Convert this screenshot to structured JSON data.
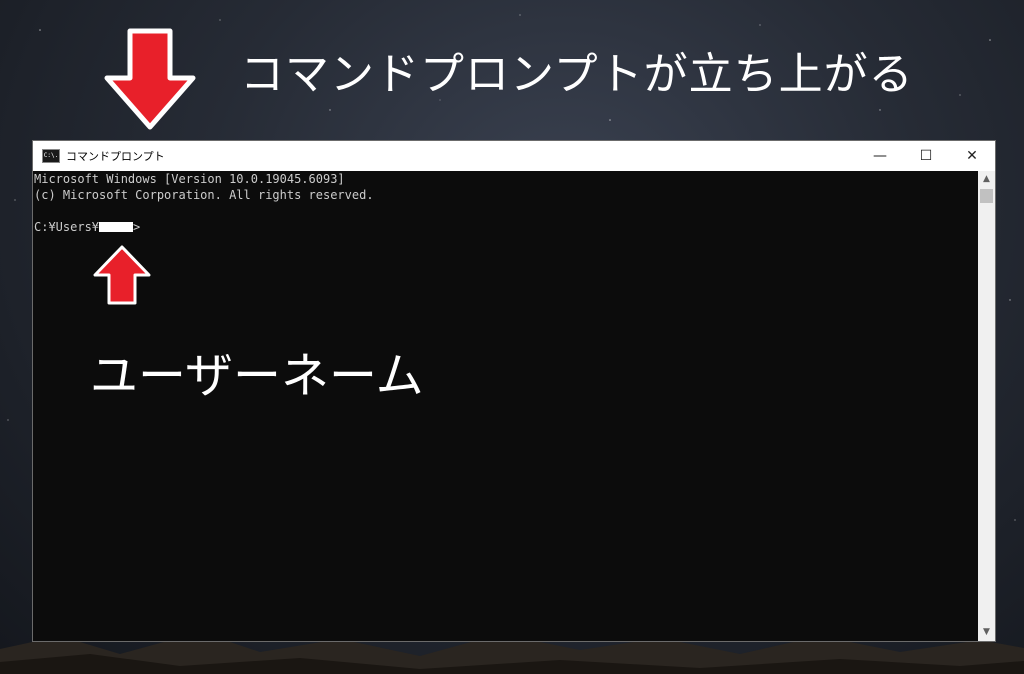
{
  "annotations": {
    "heading": "コマンドプロンプトが立ち上がる",
    "username_label": "ユーザーネーム",
    "arrow_color": "#e8202a"
  },
  "window": {
    "title": "コマンドプロンプト",
    "icon": "console-icon",
    "icon_text": "C:\\.",
    "controls": {
      "minimize": "—",
      "maximize": "☐",
      "close": "✕"
    }
  },
  "console": {
    "lines": [
      "Microsoft Windows [Version 10.0.19045.6093]",
      "(c) Microsoft Corporation. All rights reserved.",
      ""
    ],
    "prompt_prefix": "C:¥Users¥",
    "prompt_suffix": ">",
    "foreground": "#cccccc",
    "background": "#0c0c0c"
  },
  "scrollbar": {
    "up_icon": "▲",
    "down_icon": "▼"
  }
}
